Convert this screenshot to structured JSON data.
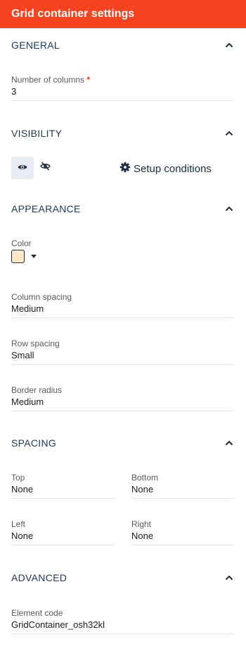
{
  "header": {
    "title": "Grid container settings"
  },
  "general": {
    "title": "GENERAL",
    "columns": {
      "label": "Number of columns",
      "required_mark": "*",
      "value": "3"
    }
  },
  "visibility": {
    "title": "VISIBILITY",
    "setup_label": "Setup conditions"
  },
  "appearance": {
    "title": "APPEARANCE",
    "color": {
      "label": "Color",
      "value_hex": "#fde6c4"
    },
    "column_spacing": {
      "label": "Column spacing",
      "value": "Medium"
    },
    "row_spacing": {
      "label": "Row spacing",
      "value": "Small"
    },
    "border_radius": {
      "label": "Border radius",
      "value": "Medium"
    }
  },
  "spacing": {
    "title": "SPACING",
    "top": {
      "label": "Top",
      "value": "None"
    },
    "bottom": {
      "label": "Bottom",
      "value": "None"
    },
    "left": {
      "label": "Left",
      "value": "None"
    },
    "right": {
      "label": "Right",
      "value": "None"
    }
  },
  "advanced": {
    "title": "ADVANCED",
    "element_code": {
      "label": "Element code",
      "value": "GridContainer_osh32kl"
    }
  },
  "colors": {
    "header_bg": "#f5431f",
    "section_title": "#1f3a60",
    "active_toggle_bg": "#e7ebf5",
    "required": "#e8321a"
  },
  "icons": [
    "chevron-up-icon",
    "eye-icon",
    "eye-off-icon",
    "gear-icon",
    "caret-down-icon"
  ]
}
